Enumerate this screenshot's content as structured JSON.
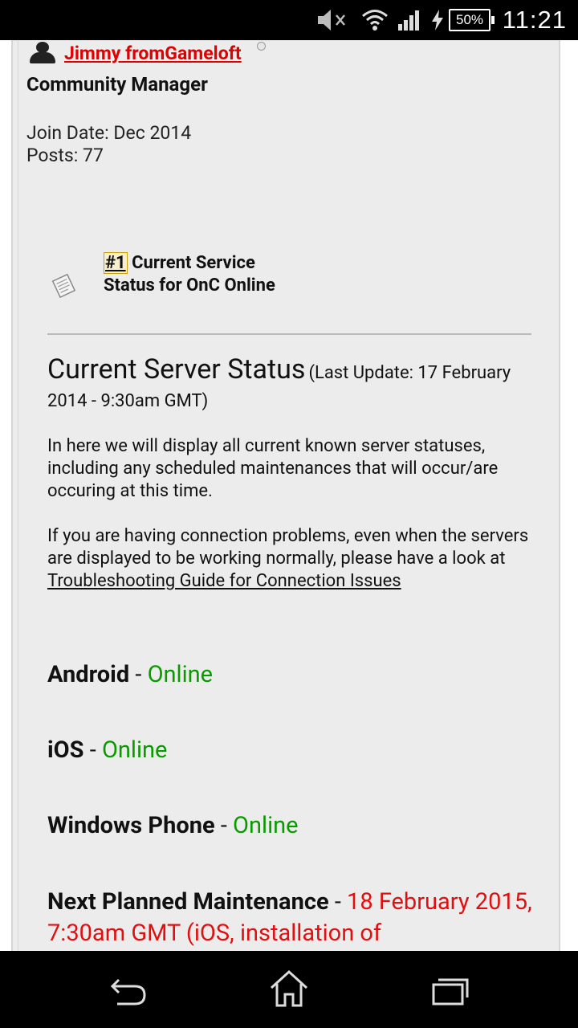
{
  "status_bar": {
    "time": "11:21",
    "battery_percent": "50%",
    "icons": [
      "mute-icon",
      "wifi-icon",
      "signal-icon",
      "charging-icon",
      "battery-icon"
    ]
  },
  "post": {
    "username": "Jimmy fromGameloft",
    "user_title": "Community Manager",
    "join_date": "Join Date: Dec 2014",
    "posts": "Posts: 77",
    "post_number": "#1",
    "post_title": "Current Service Status for OnC Online"
  },
  "content": {
    "heading": "Current Server Status",
    "heading_note": "(Last Update: 17 February 2014 - 9:30am GMT)",
    "paragraph1": "In here we will display all current known server statuses, including any scheduled maintenances that will occur/are occuring at this time.",
    "paragraph2_text": "If you are having connection problems, even when the servers are displayed to be working normally, please have a look at ",
    "paragraph2_link": "Troubleshooting Guide for Connection Issues",
    "separator": "-",
    "platforms": [
      {
        "name": "Android",
        "status": "Online"
      },
      {
        "name": "iOS",
        "status": "Online"
      },
      {
        "name": "Windows Phone",
        "status": "Online"
      }
    ],
    "maintenance_label": "Next Planned Maintenance",
    "maintenance_value": "18 February 2015, 7:30am GMT (iOS, installation of"
  },
  "colors": {
    "username": "#e00000",
    "online": "#0a9a00",
    "maintenance": "#e01010"
  },
  "nav_bar": {
    "icons": [
      "back-icon",
      "home-icon",
      "recent-apps-icon"
    ]
  }
}
